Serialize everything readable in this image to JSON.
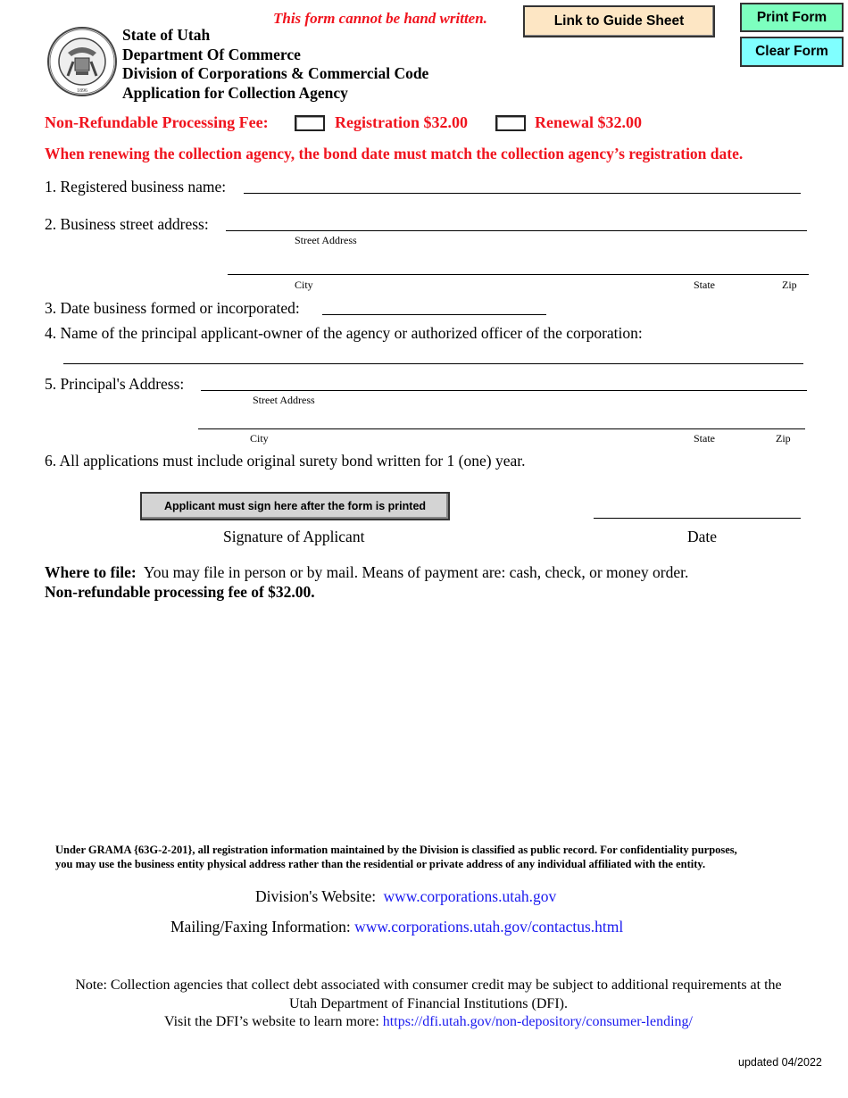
{
  "header": {
    "warning": "This form cannot be hand written.",
    "lines": [
      "State of Utah",
      "Department Of Commerce",
      "Division of Corporations & Commercial Code",
      "Application for Collection Agency"
    ],
    "seal": "state-seal-icon"
  },
  "buttons": {
    "guide": "Link to Guide Sheet",
    "print": "Print Form",
    "clear": "Clear Form",
    "sign": "Applicant must sign here after the form is printed"
  },
  "colors": {
    "red": "#f0141e",
    "guide_bg": "#fde6c4",
    "print_bg": "#7dffbf",
    "clear_bg": "#80ffff",
    "link": "#1a1aef"
  },
  "fee": {
    "label": "Non-Refundable Processing Fee:",
    "options": [
      {
        "label": "Registration $32.00",
        "checked": false
      },
      {
        "label": "Renewal $32.00",
        "checked": false
      }
    ]
  },
  "renewal_notice": "When renewing the collection agency, the bond date must match the collection agency’s registration date.",
  "questions": {
    "q1": "1. Registered business name:",
    "q2": "2. Business street address:",
    "q3": "3. Date business formed or incorporated:",
    "q4": "4. Name of the principal applicant-owner of the agency or authorized officer of the corporation:",
    "q5": "5. Principal's Address:",
    "q6": "6.  All applications must include original surety bond written for 1 (one) year."
  },
  "sublabels": {
    "street": "Street Address",
    "city": "City",
    "state": "State",
    "zip": "Zip"
  },
  "signature": {
    "label": "Signature of Applicant",
    "date_label": "Date"
  },
  "filing": {
    "bold": "Where to file:",
    "text": "You may file in person or by mail. Means of payment are: cash, check, or money order.",
    "fee_line": "Non-refundable processing fee of $32.00."
  },
  "footer": {
    "grama_1": "Under GRAMA {63G-2-201}, all registration information maintained by the Division is classified as public record.  For confidentiality purposes,",
    "grama_2": "you may use the business entity physical address rather than the residential or private address of any individual affiliated with the entity.",
    "website_label": "Division's Website:",
    "website_url": "www.corporations.utah.gov",
    "mailing_label": "Mailing/Faxing Information:",
    "mailing_url": "www.corporations.utah.gov/contactus.html",
    "note_1": "Note: Collection agencies that collect debt associated with consumer credit may be subject to additional requirements at the",
    "note_2": "Utah Department of Financial Institutions (DFI).",
    "note_3": "Visit the DFI’s website to learn more:",
    "dfi_url": "https://dfi.utah.gov/non-depository/consumer-lending/",
    "updated": "updated 04/2022"
  }
}
